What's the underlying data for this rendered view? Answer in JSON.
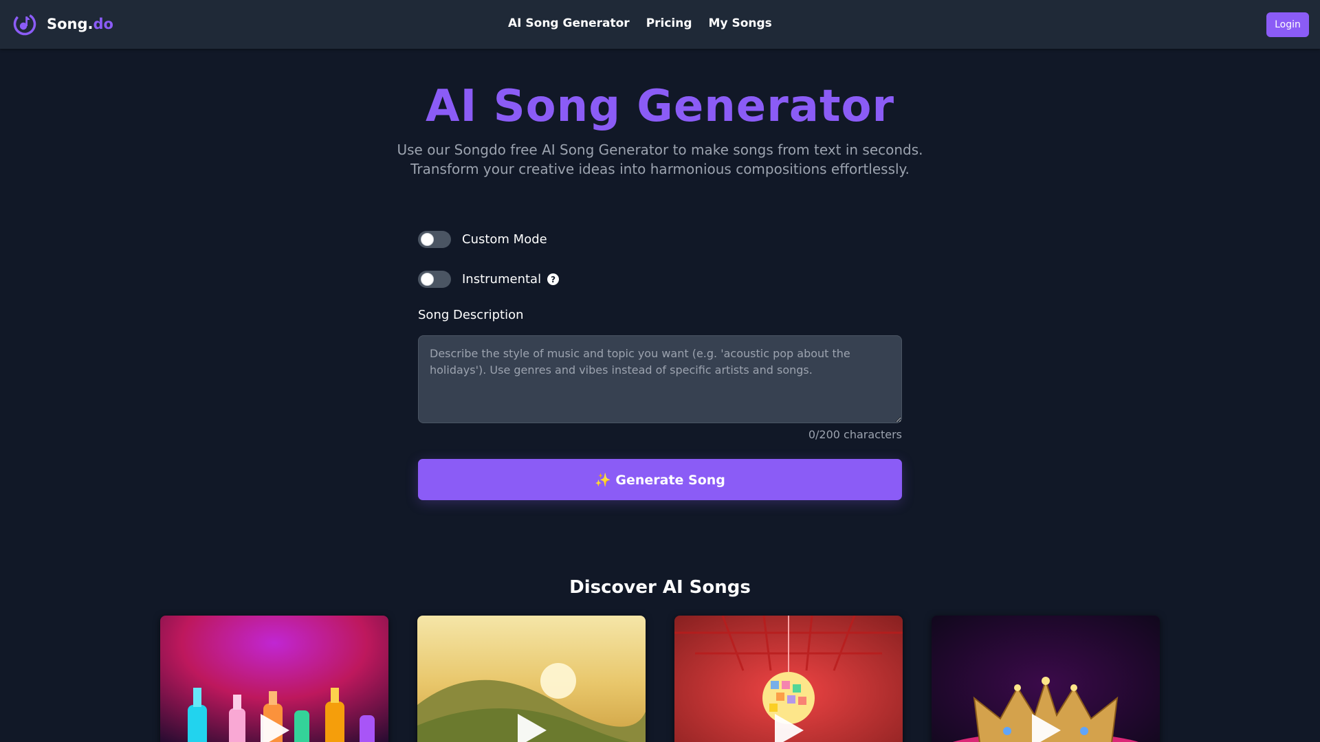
{
  "header": {
    "logo_name": "Song.",
    "logo_suffix": "do",
    "nav": [
      "AI Song Generator",
      "Pricing",
      "My Songs"
    ],
    "login_label": "Login"
  },
  "hero": {
    "title": "AI Song Generator",
    "subtitle_line1": "Use our Songdo free AI Song Generator to make songs from text in seconds.",
    "subtitle_line2": "Transform your creative ideas into harmonious compositions effortlessly."
  },
  "form": {
    "custom_mode_label": "Custom Mode",
    "custom_mode_on": false,
    "instrumental_label": "Instrumental",
    "instrumental_on": false,
    "description_label": "Song Description",
    "description_value": "",
    "description_placeholder": "Describe the style of music and topic you want (e.g. 'acoustic pop about the holidays'). Use genres and vibes instead of specific artists and songs.",
    "char_count": "0/200 characters",
    "generate_label": "✨ Generate Song"
  },
  "discover": {
    "title": "Discover AI Songs",
    "cards": [
      {
        "icon": "play-icon"
      },
      {
        "icon": "play-icon"
      },
      {
        "icon": "play-icon"
      },
      {
        "icon": "play-icon"
      }
    ]
  },
  "colors": {
    "accent": "#8b5cf6",
    "background": "#111827",
    "header": "#1f2937"
  }
}
